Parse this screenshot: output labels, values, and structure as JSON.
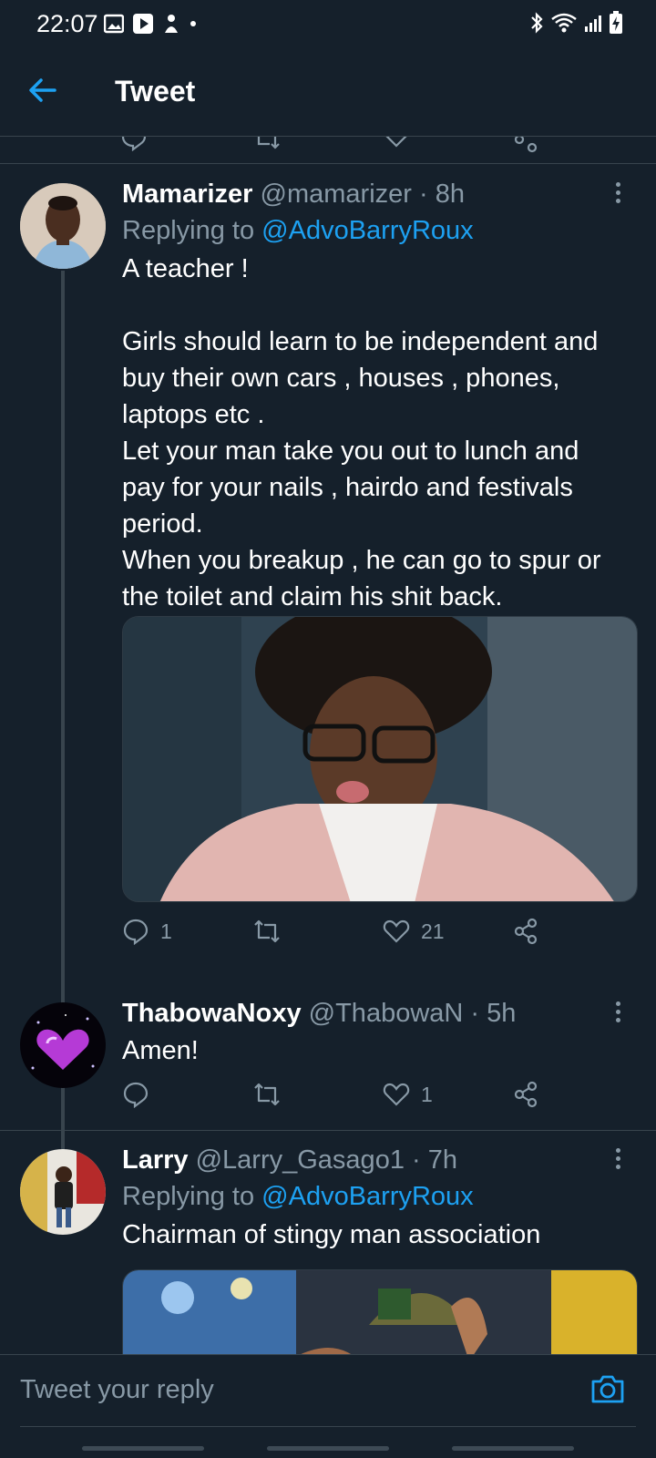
{
  "status": {
    "time": "22:07"
  },
  "header": {
    "title": "Tweet"
  },
  "tweets": [
    {
      "name": "Mamarizer",
      "handle": "@mamarizer",
      "age": "8h",
      "replying_label": "Replying to",
      "replying_to": "@AdvoBarryRoux",
      "text": "A teacher !\n\nGirls should learn to be independent and buy their own cars , houses , phones, laptops etc .\nLet your man take you out to lunch and pay for your nails , hairdo and festivals period.\nWhen you breakup , he can go to spur or the toilet and claim his shit back.",
      "replies": "1",
      "retweets": "",
      "likes": "21"
    },
    {
      "name": "ThabowaNoxy",
      "handle": "@ThabowaN",
      "age": "5h",
      "text": "Amen!",
      "replies": "",
      "retweets": "",
      "likes": "1"
    },
    {
      "name": "Larry",
      "handle": "@Larry_Gasago1",
      "age": "7h",
      "replying_label": "Replying to",
      "replying_to": "@AdvoBarryRoux",
      "text": "Chairman of stingy man association"
    }
  ],
  "reply_bar": {
    "placeholder": "Tweet your reply"
  },
  "colors": {
    "background": "#15202b",
    "accent": "#1da1f2",
    "muted": "#8899a6",
    "divider": "#38444d"
  },
  "icons": [
    "back-arrow-icon",
    "more-vertical-icon",
    "reply-icon",
    "retweet-icon",
    "like-icon",
    "share-icon",
    "camera-icon"
  ]
}
